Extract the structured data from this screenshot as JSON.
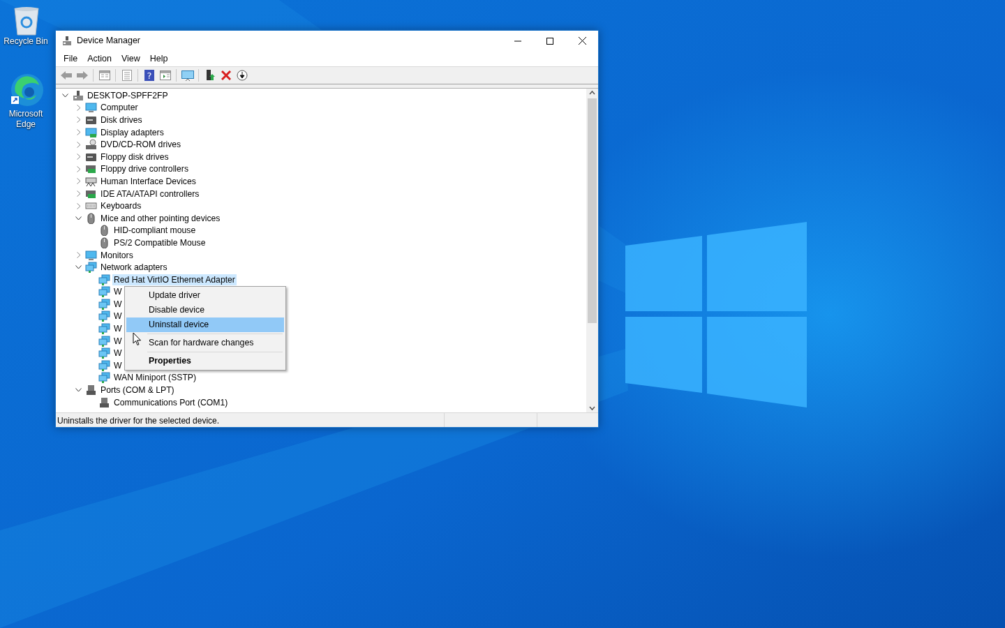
{
  "desktop_icons": [
    {
      "label": "Recycle Bin",
      "kind": "bin"
    },
    {
      "label": "Microsoft Edge",
      "kind": "edge"
    }
  ],
  "window": {
    "title": "Device Manager"
  },
  "menu_bar": [
    "File",
    "Action",
    "View",
    "Help"
  ],
  "toolbar": {
    "help_glyph": "?"
  },
  "tree": {
    "label": "DESKTOP-SPFF2FP",
    "kind": "pc",
    "expanded": true,
    "selected": false,
    "children": [
      {
        "label": "Computer",
        "kind": "monitor",
        "expanded": false,
        "selected": false
      },
      {
        "label": "Disk drives",
        "kind": "disk",
        "expanded": false,
        "selected": false
      },
      {
        "label": "Display adapters",
        "kind": "display",
        "expanded": false,
        "selected": false
      },
      {
        "label": "DVD/CD-ROM drives",
        "kind": "dvd",
        "expanded": false,
        "selected": false
      },
      {
        "label": "Floppy disk drives",
        "kind": "disk",
        "expanded": false,
        "selected": false
      },
      {
        "label": "Floppy drive controllers",
        "kind": "card",
        "expanded": false,
        "selected": false
      },
      {
        "label": "Human Interface Devices",
        "kind": "hid",
        "expanded": false,
        "selected": false
      },
      {
        "label": "IDE ATA/ATAPI controllers",
        "kind": "card",
        "expanded": false,
        "selected": false
      },
      {
        "label": "Keyboards",
        "kind": "keyboard",
        "expanded": false,
        "selected": false
      },
      {
        "label": "Mice and other pointing devices",
        "kind": "mouse",
        "expanded": true,
        "selected": false,
        "children": [
          {
            "label": "HID-compliant mouse",
            "kind": "mouse",
            "selected": false
          },
          {
            "label": "PS/2 Compatible Mouse",
            "kind": "mouse",
            "selected": false
          }
        ]
      },
      {
        "label": "Monitors",
        "kind": "monitor",
        "expanded": false,
        "selected": false
      },
      {
        "label": "Network adapters",
        "kind": "network",
        "expanded": true,
        "selected": false,
        "children": [
          {
            "label": "Red Hat VirtIO Ethernet Adapter",
            "kind": "network",
            "selected": true
          },
          {
            "label": "W",
            "kind": "network",
            "selected": false
          },
          {
            "label": "W",
            "kind": "network",
            "selected": false
          },
          {
            "label": "W",
            "kind": "network",
            "selected": false
          },
          {
            "label": "W",
            "kind": "network",
            "selected": false
          },
          {
            "label": "W",
            "kind": "network",
            "selected": false
          },
          {
            "label": "W",
            "kind": "network",
            "selected": false
          },
          {
            "label": "W",
            "kind": "network",
            "selected": false
          },
          {
            "label": "WAN Miniport (SSTP)",
            "kind": "network",
            "selected": false
          }
        ]
      },
      {
        "label": "Ports (COM & LPT)",
        "kind": "port",
        "expanded": true,
        "selected": false,
        "children": [
          {
            "label": "Communications Port (COM1)",
            "kind": "port",
            "selected": false
          }
        ]
      }
    ]
  },
  "context_menu": [
    {
      "kind": "item",
      "label": "Update driver",
      "selected": false
    },
    {
      "kind": "item",
      "label": "Disable device",
      "selected": false
    },
    {
      "kind": "item",
      "label": "Uninstall device",
      "selected": true
    },
    {
      "kind": "separator"
    },
    {
      "kind": "item",
      "label": "Scan for hardware changes",
      "selected": false
    },
    {
      "kind": "separator"
    },
    {
      "kind": "item",
      "label": "Properties",
      "selected": false,
      "bold": true
    }
  ],
  "status_bar": {
    "text": "Uninstalls the driver for the selected device."
  }
}
